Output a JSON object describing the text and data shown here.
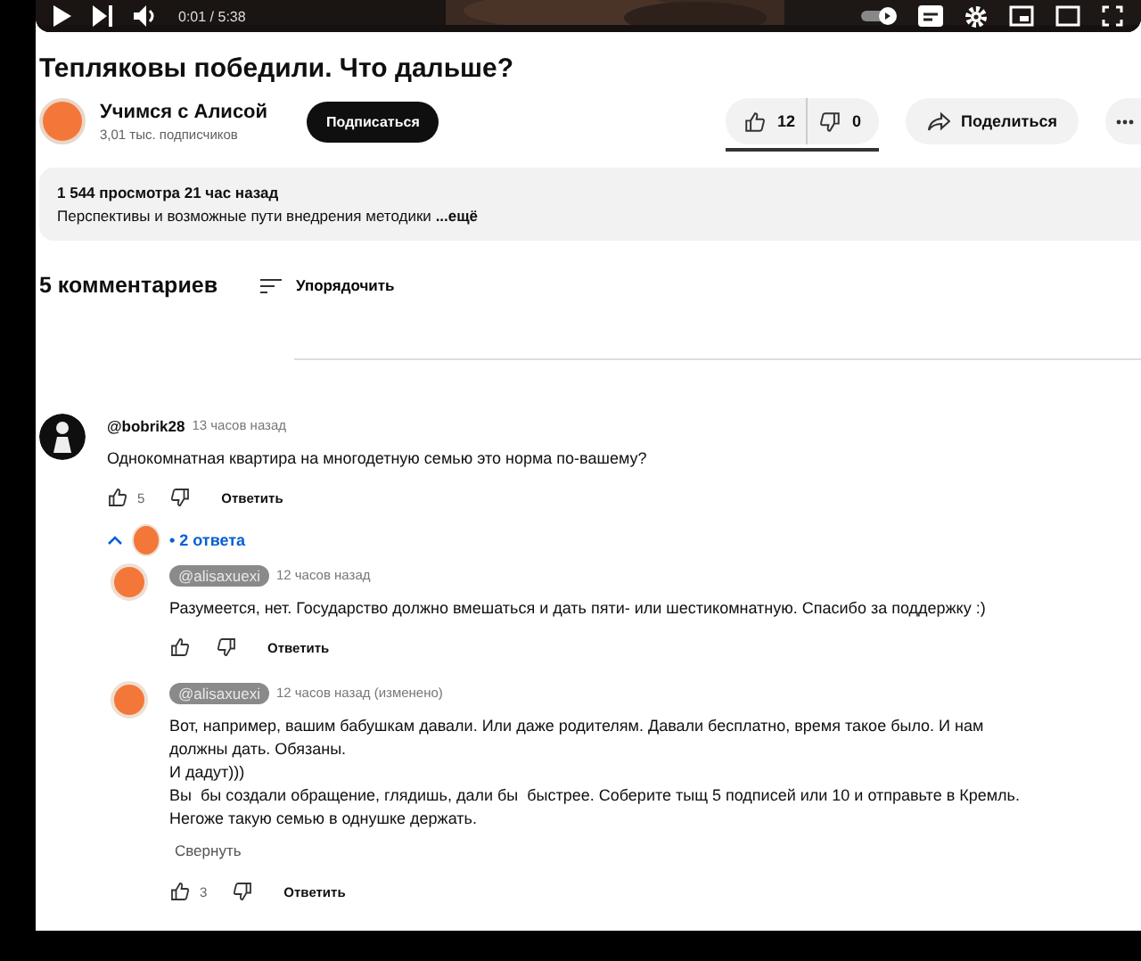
{
  "player": {
    "time": "0:01 / 5:38"
  },
  "video": {
    "title": "Тепляковы победили. Что дальше?",
    "channel": "Учимся с Алисой",
    "subscribers": "3,01 тыс. подписчиков",
    "subscribe": "Подписаться",
    "likes": "12",
    "dislikes": "0",
    "share": "Поделиться"
  },
  "description": {
    "stats": "1 544 просмотра  21 час назад",
    "text": "Перспективы и возможные пути внедрения методики",
    "more": "...ещё"
  },
  "comments_header": {
    "count": "5 комментариев",
    "sort": "Упорядочить"
  },
  "comments": [
    {
      "author": "@bobrik28",
      "owner": false,
      "time": "13 часов назад",
      "text": "Однокомнатная квартира на многодетную семью это норма по-вашему?",
      "likes": "5",
      "reply": "Ответить",
      "replies_toggle": {
        "label": "• 2 ответа",
        "expanded": true
      },
      "children": [
        {
          "author": "@alisaxuexi",
          "owner": true,
          "time": "12 часов назад",
          "text": "Разумеется, нет. Государство должно вмешаться и дать пяти- или шестикомнатную. Спасибо за поддержку :)",
          "reply": "Ответить"
        },
        {
          "author": "@alisaxuexi",
          "owner": true,
          "time": "12 часов назад (изменено)",
          "text": "Вот, например, вашим бабушкам давали. Или даже родителям. Давали бесплатно, время такое было. И нам должны дать. Обязаны.\nИ дадут)))\nВы  бы создали обращение, глядишь, дали бы  быстрее. Соберите тыщ 5 подписей или 10 и отправьте в Кремль. Негоже такую семью в однушке держать.",
          "collapse": "Свернуть",
          "likes": "3",
          "reply": "Ответить"
        }
      ]
    }
  ]
}
